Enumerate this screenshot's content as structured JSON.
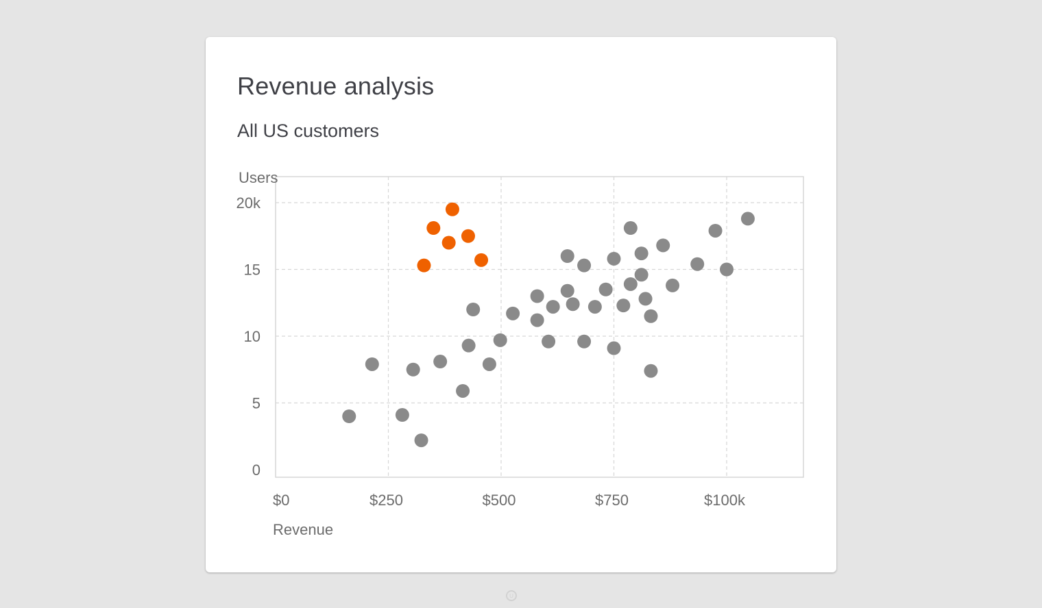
{
  "card": {
    "title": "Revenue analysis",
    "subtitle": "All US customers"
  },
  "colors": {
    "background": "#e5e5e5",
    "card": "#ffffff",
    "highlight": "#ef6100",
    "normal": "#8a8a8a",
    "grid": "#d6d6d6",
    "text": "#3f4046",
    "axis_text": "#6b6b6b"
  },
  "watermark": {
    "icon": "ui-logo-icon"
  },
  "chart_data": {
    "type": "scatter",
    "xlabel": "Revenue",
    "ylabel": "Users",
    "x_ticks": [
      {
        "value": 0,
        "label": "$0"
      },
      {
        "value": 250,
        "label": "$250"
      },
      {
        "value": 500,
        "label": "$500"
      },
      {
        "value": 750,
        "label": "$750"
      },
      {
        "value": 1000,
        "label": "$100k"
      }
    ],
    "y_ticks": [
      {
        "value": 0,
        "label": "0"
      },
      {
        "value": 5,
        "label": "5"
      },
      {
        "value": 10,
        "label": "10"
      },
      {
        "value": 15,
        "label": "15"
      },
      {
        "value": 20,
        "label": "20k"
      }
    ],
    "xlim": [
      0,
      1175
    ],
    "ylim": [
      -0.5,
      22
    ],
    "grid": true,
    "series": [
      {
        "highlight": true,
        "color": "#ef6100",
        "points": [
          [
            392,
            19.5
          ],
          [
            350,
            18.1
          ],
          [
            384,
            17.0
          ],
          [
            427,
            17.5
          ],
          [
            456,
            15.7
          ],
          [
            329,
            15.3
          ]
        ]
      },
      {
        "highlight": false,
        "color": "#8a8a8a",
        "points": [
          [
            163,
            4.0
          ],
          [
            214,
            7.9
          ],
          [
            281,
            4.1
          ],
          [
            305,
            7.5
          ],
          [
            323,
            2.2
          ],
          [
            365,
            8.1
          ],
          [
            415,
            5.9
          ],
          [
            428,
            9.3
          ],
          [
            438,
            12.0
          ],
          [
            474,
            7.9
          ],
          [
            498,
            9.7
          ],
          [
            526,
            11.7
          ],
          [
            580,
            13.0
          ],
          [
            580,
            11.2
          ],
          [
            605,
            9.6
          ],
          [
            615,
            12.2
          ],
          [
            647,
            13.4
          ],
          [
            647,
            16.0
          ],
          [
            659,
            12.4
          ],
          [
            684,
            15.3
          ],
          [
            684,
            9.6
          ],
          [
            708,
            12.2
          ],
          [
            732,
            13.5
          ],
          [
            750,
            15.8
          ],
          [
            750,
            9.1
          ],
          [
            771,
            12.3
          ],
          [
            787,
            18.1
          ],
          [
            787,
            13.9
          ],
          [
            811,
            16.2
          ],
          [
            811,
            14.6
          ],
          [
            820,
            12.8
          ],
          [
            832,
            11.5
          ],
          [
            832,
            7.4
          ],
          [
            859,
            16.8
          ],
          [
            880,
            13.8
          ],
          [
            935,
            15.4
          ],
          [
            975,
            17.9
          ],
          [
            1000,
            15.0
          ],
          [
            1047,
            18.8
          ]
        ]
      }
    ]
  }
}
